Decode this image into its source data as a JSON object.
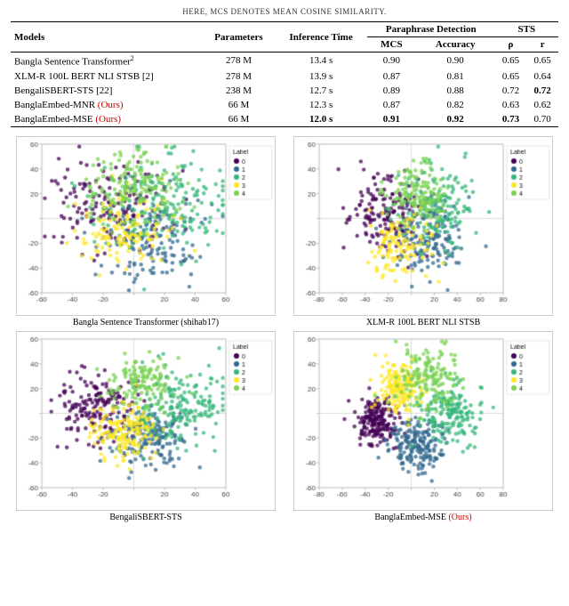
{
  "header": {
    "note": "Here, MCS denotes Mean Cosine Similarity."
  },
  "table": {
    "columns": {
      "models": "Models",
      "parameters": "Parameters",
      "inference_time": "Inference Time",
      "paraphrase_detection": "Paraphrase Detection",
      "mcs": "MCS",
      "accuracy": "Accuracy",
      "sts": "STS",
      "rho": "ρ",
      "r": "r"
    },
    "rows": [
      {
        "model": "Bangla Sentence Transformer",
        "sup": "2",
        "params": "278 M",
        "inf_time": "13.4 s",
        "mcs": "0.90",
        "acc": "0.90",
        "rho": "0.65",
        "r": "0.65",
        "bold_r": false,
        "ours": false
      },
      {
        "model": "XLM-R 100L BERT NLI STSB [2]",
        "sup": "",
        "params": "278 M",
        "inf_time": "13.9 s",
        "mcs": "0.87",
        "acc": "0.81",
        "rho": "0.65",
        "r": "0.64",
        "bold_r": false,
        "ours": false
      },
      {
        "model": "BengaliSBERT-STS [22]",
        "sup": "",
        "params": "238 M",
        "inf_time": "12.7 s",
        "mcs": "0.89",
        "acc": "0.88",
        "rho": "0.72",
        "r": "0.72",
        "bold_r": true,
        "ours": false
      },
      {
        "model": "BanglaEmbed-MNR",
        "ours_tag": "(Ours)",
        "params": "66 M",
        "inf_time": "12.3 s",
        "mcs": "0.87",
        "acc": "0.82",
        "rho": "0.63",
        "r": "0.62",
        "bold_r": false,
        "ours": true
      },
      {
        "model": "BanglaEmbed-MSE",
        "ours_tag": "(Ours)",
        "params": "66 M",
        "inf_time": "12.0 s",
        "mcs": "0.91",
        "acc": "0.92",
        "rho": "0.73",
        "r": "0.70",
        "bold_inf": true,
        "bold_mcs": true,
        "bold_acc": true,
        "bold_rho": true,
        "ours": true
      }
    ]
  },
  "plots": [
    {
      "id": "plot1",
      "title": "Bangla Sentence Transformer (shihab17)",
      "ours": false
    },
    {
      "id": "plot2",
      "title": "XLM-R 100L BERT NLI STSB",
      "ours": false
    },
    {
      "id": "plot3",
      "title": "BengaliSBERT-STS",
      "ours": false
    },
    {
      "id": "plot4",
      "title": "BanglaEmbed-MSE (Ours)",
      "ours": true
    }
  ],
  "legend": {
    "title": "Label",
    "items": [
      {
        "value": "0",
        "color": "#440154"
      },
      {
        "value": "1",
        "color": "#31688e"
      },
      {
        "value": "2",
        "color": "#35b779"
      },
      {
        "value": "3",
        "color": "#fde725"
      },
      {
        "value": "4",
        "color": "#90d743"
      }
    ]
  }
}
